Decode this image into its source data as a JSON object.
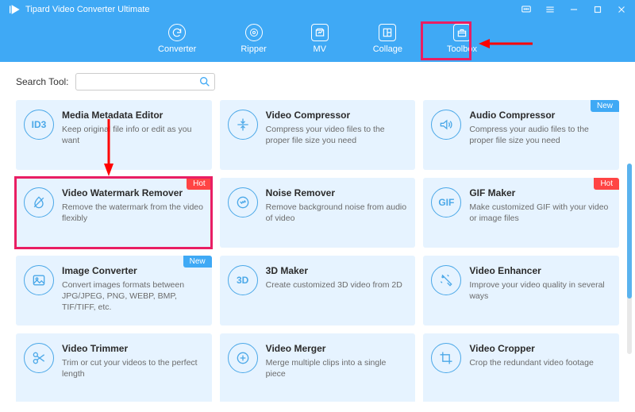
{
  "app": {
    "title": "Tipard Video Converter Ultimate"
  },
  "nav": {
    "converter": "Converter",
    "ripper": "Ripper",
    "mv": "MV",
    "collage": "Collage",
    "toolbox": "Toolbox"
  },
  "search": {
    "label": "Search Tool:",
    "value": ""
  },
  "badges": {
    "new": "New",
    "hot": "Hot"
  },
  "tools": {
    "media_metadata": {
      "title": "Media Metadata Editor",
      "desc": "Keep original file info or edit as you want",
      "icon": "ID3"
    },
    "video_compressor": {
      "title": "Video Compressor",
      "desc": "Compress your video files to the proper file size you need"
    },
    "audio_compressor": {
      "title": "Audio Compressor",
      "desc": "Compress your audio files to the proper file size you need"
    },
    "watermark_remover": {
      "title": "Video Watermark Remover",
      "desc": "Remove the watermark from the video flexibly"
    },
    "noise_remover": {
      "title": "Noise Remover",
      "desc": "Remove background noise from audio of video"
    },
    "gif_maker": {
      "title": "GIF Maker",
      "desc": "Make customized GIF with your video or image files",
      "icon": "GIF"
    },
    "image_converter": {
      "title": "Image Converter",
      "desc": "Convert images formats between JPG/JPEG, PNG, WEBP, BMP, TIF/TIFF, etc."
    },
    "three_d_maker": {
      "title": "3D Maker",
      "desc": "Create customized 3D video from 2D",
      "icon": "3D"
    },
    "video_enhancer": {
      "title": "Video Enhancer",
      "desc": "Improve your video quality in several ways"
    },
    "video_trimmer": {
      "title": "Video Trimmer",
      "desc": "Trim or cut your videos to the perfect length"
    },
    "video_merger": {
      "title": "Video Merger",
      "desc": "Merge multiple clips into a single piece"
    },
    "video_cropper": {
      "title": "Video Cropper",
      "desc": "Crop the redundant video footage"
    }
  }
}
